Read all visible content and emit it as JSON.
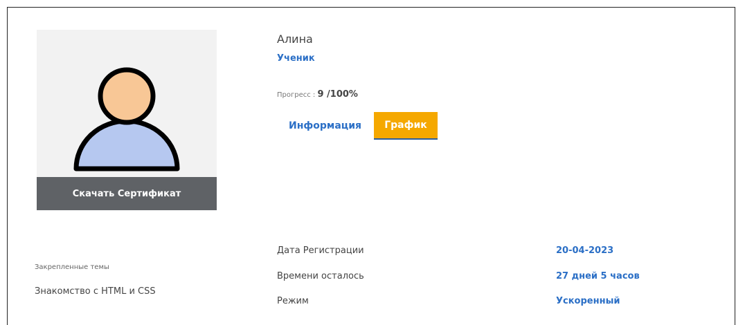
{
  "profile": {
    "name": "Алина",
    "role": "Ученик",
    "progress_label": "Прогресс : ",
    "progress_value": "9 /100%",
    "avatar_icon": "user-avatar-icon"
  },
  "buttons": {
    "download_certificate": "Скачать Сертификат"
  },
  "tabs": [
    {
      "label": "Информация",
      "active": false
    },
    {
      "label": "График",
      "active": true
    }
  ],
  "pinned": {
    "label": "Закрепленные темы",
    "topic": "Знакомство с HTML и CSS"
  },
  "details": [
    {
      "label": "Дата Регистрации",
      "value": "20-04-2023"
    },
    {
      "label": "Времени осталось",
      "value": "27 дней 5 часов"
    },
    {
      "label": "Режим",
      "value": "Ускоренный"
    }
  ],
  "colors": {
    "accent_blue": "#2b6fc6",
    "tab_active": "#f5a800",
    "button_dark": "#5f6266",
    "avatar_face": "#f8c796",
    "avatar_body": "#b6c8f0"
  }
}
